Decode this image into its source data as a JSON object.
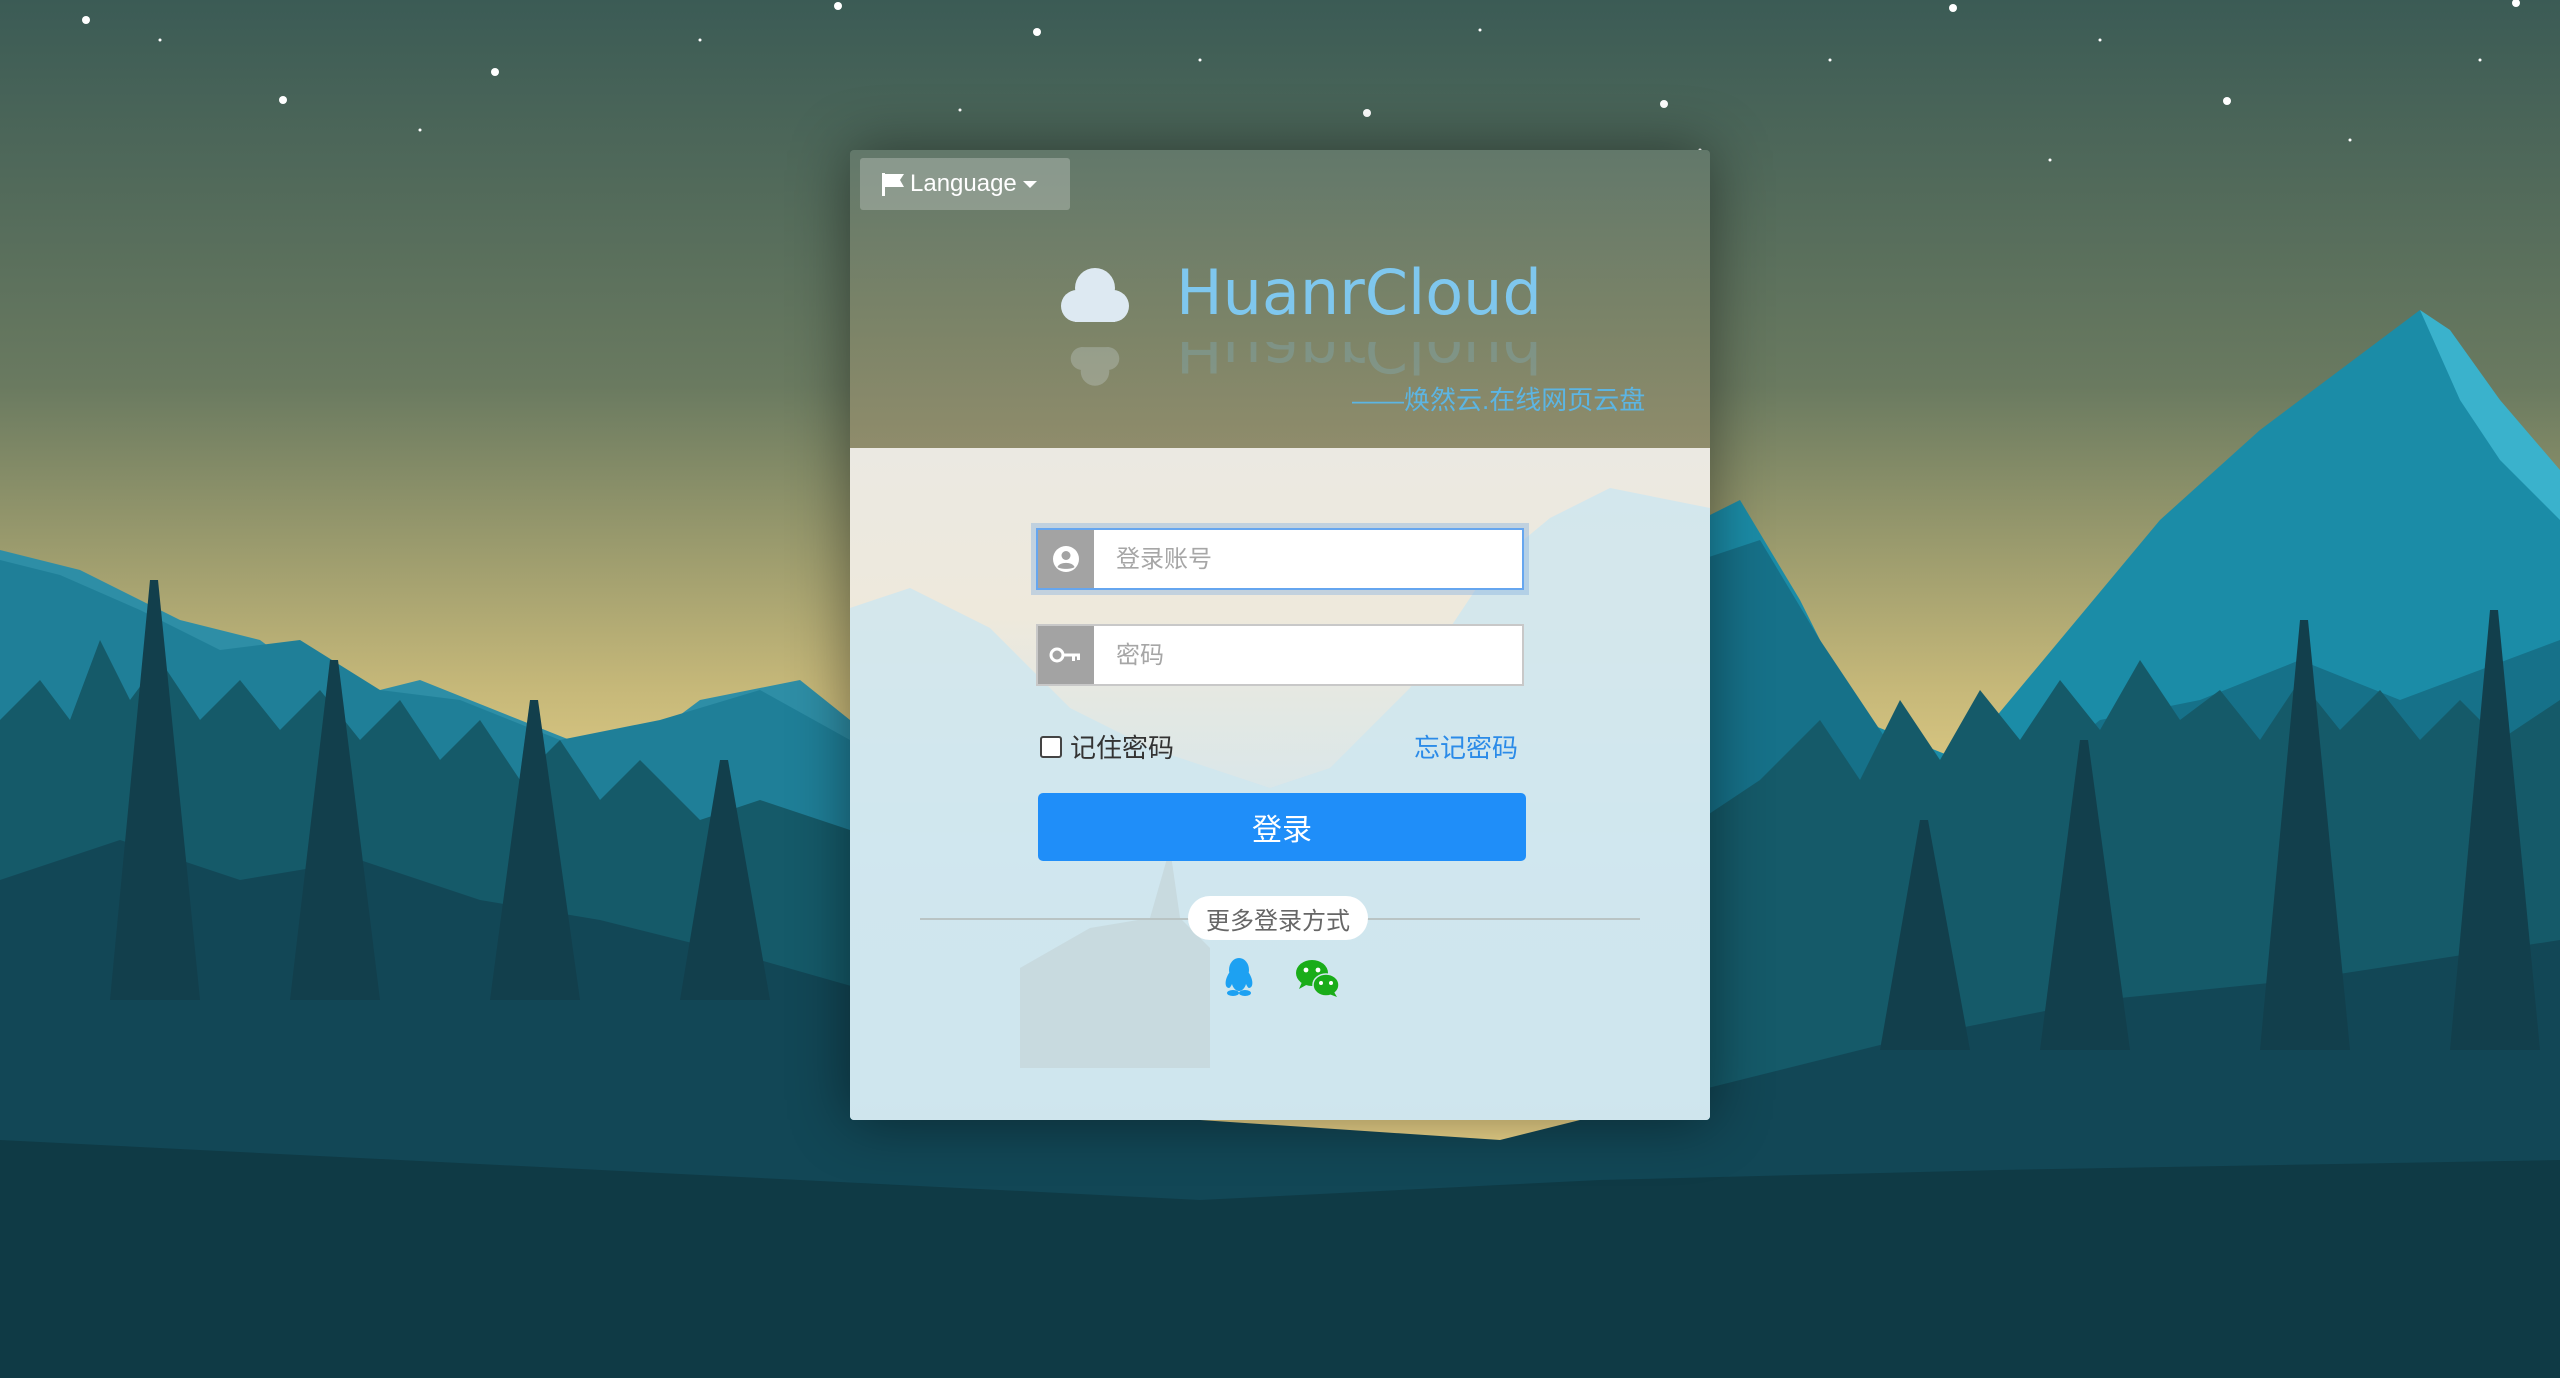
{
  "language_menu": {
    "label": "Language",
    "icon": "flag-icon"
  },
  "brand": {
    "name": "HuanrCloud",
    "tagline": "——焕然云.在线网页云盘",
    "icon": "cloud-icon"
  },
  "login_form": {
    "username_placeholder": "登录账号",
    "password_placeholder": "密码",
    "username_value": "",
    "password_value": "",
    "remember_label": "记住密码",
    "remember_checked": false,
    "forgot_label": "忘记密码",
    "submit_label": "登录"
  },
  "alt_login": {
    "label": "更多登录方式",
    "providers": [
      {
        "name": "QQ",
        "icon": "qq-icon",
        "color": "#1da1f2"
      },
      {
        "name": "WeChat",
        "icon": "wechat-icon",
        "color": "#1aad19"
      }
    ]
  },
  "colors": {
    "accent": "#1f8ef9",
    "brand_text": "#7fc7ee",
    "link": "#2b8be8"
  }
}
